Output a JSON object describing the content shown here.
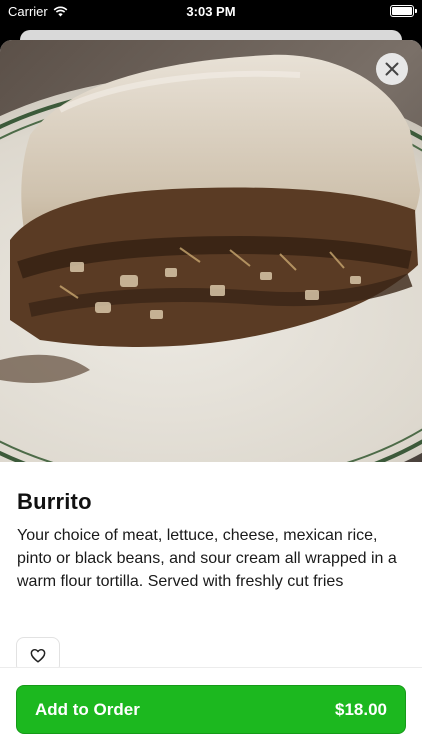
{
  "status_bar": {
    "carrier": "Carrier",
    "time": "3:03 PM",
    "icons": {
      "wifi": "wifi-icon",
      "battery": "battery-icon"
    }
  },
  "item": {
    "name": "Burrito",
    "description": "Your choice of meat, lettuce, cheese, mexican rice, pinto or black beans, and sour cream all wrapped in a warm flour tortilla. Served with freshly cut fries",
    "image_alt": "Burrito"
  },
  "icons": {
    "close": "close-icon",
    "favorite": "heart-icon"
  },
  "footer": {
    "add_label": "Add to Order",
    "price": "$18.00"
  },
  "colors": {
    "accent": "#1cb81f",
    "accent_border": "#169a19"
  }
}
